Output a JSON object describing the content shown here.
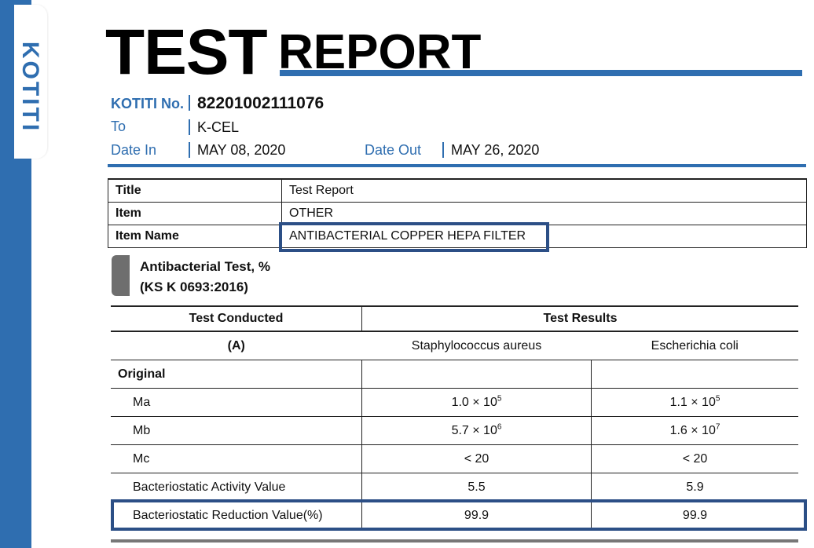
{
  "brand": {
    "logo_text": "KOTITI",
    "accent": "#2f6eb0",
    "highlight": "#2c4f86"
  },
  "title": {
    "word1": "TEST",
    "word2": "REPORT"
  },
  "meta": {
    "no_label": "KOTITI No.",
    "no_value": "82201002111076",
    "to_label": "To",
    "to_value": "K-CEL",
    "date_in_label": "Date In",
    "date_in_value": "MAY 08, 2020",
    "date_out_label": "Date Out",
    "date_out_value": "MAY 26, 2020"
  },
  "info": [
    {
      "key": "Title",
      "value": "Test Report"
    },
    {
      "key": "Item",
      "value": "OTHER"
    },
    {
      "key": "Item Name",
      "value": "ANTIBACTERIAL COPPER HEPA FILTER"
    }
  ],
  "section": {
    "line1": "Antibacterial Test, %",
    "line2": "(KS K 0693:2016)"
  },
  "results": {
    "head_conducted": "Test Conducted",
    "head_results": "Test Results",
    "sub_label": "(A)",
    "organism1": "Staphylococcus aureus",
    "organism2": "Escherichia coli",
    "group_label": "Original",
    "rows": [
      {
        "label": "Ma",
        "v1": "1.0 × 10",
        "e1": "5",
        "v2": "1.1 × 10",
        "e2": "5"
      },
      {
        "label": "Mb",
        "v1": "5.7 × 10",
        "e1": "6",
        "v2": "1.6 × 10",
        "e2": "7"
      },
      {
        "label": "Mc",
        "v1": "< 20",
        "e1": "",
        "v2": "< 20",
        "e2": ""
      },
      {
        "label": "Bacteriostatic Activity Value",
        "v1": "5.5",
        "e1": "",
        "v2": "5.9",
        "e2": ""
      },
      {
        "label": "Bacteriostatic Reduction Value(%)",
        "v1": "99.9",
        "e1": "",
        "v2": "99.9",
        "e2": ""
      }
    ]
  }
}
